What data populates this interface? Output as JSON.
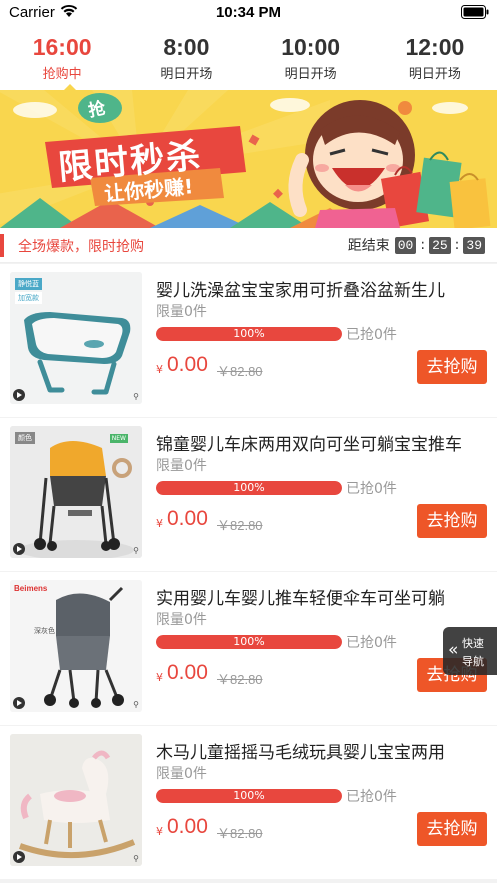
{
  "status_bar": {
    "carrier": "Carrier",
    "time": "10:34 PM"
  },
  "tabs": [
    {
      "time": "16:00",
      "status": "抢购中",
      "active": true
    },
    {
      "time": "8:00",
      "status": "明日开场",
      "active": false
    },
    {
      "time": "10:00",
      "status": "明日开场",
      "active": false
    },
    {
      "time": "12:00",
      "status": "明日开场",
      "active": false
    }
  ],
  "banner": {
    "badge": "抢",
    "headline": "限时秒杀",
    "subline": "让你秒赚!"
  },
  "strip": {
    "title": "全场爆款，限时抢购",
    "countdown_label": "距结束",
    "hours": "00",
    "minutes": "25",
    "seconds": "39"
  },
  "products": [
    {
      "title": "婴儿洗澡盆宝宝家用可折叠浴盆新生儿",
      "limit": "限量0件",
      "progress_label": "100%",
      "progress": 1.0,
      "sold": "已抢0件",
      "currency": "¥",
      "price": "0.00",
      "original_price": "￥82.80",
      "button": "去抢购",
      "thumb_badge": "静悦蓝",
      "thumb_badge2": "加宽款"
    },
    {
      "title": "锦童婴儿车床两用双向可坐可躺宝宝推车",
      "limit": "限量0件",
      "progress_label": "100%",
      "progress": 1.0,
      "sold": "已抢0件",
      "currency": "¥",
      "price": "0.00",
      "original_price": "￥82.80",
      "button": "去抢购",
      "thumb_badge": "颜色",
      "thumb_tag": "NEW"
    },
    {
      "title": "实用婴儿车婴儿推车轻便伞车可坐可躺",
      "limit": "限量0件",
      "progress_label": "100%",
      "progress": 1.0,
      "sold": "已抢0件",
      "currency": "¥",
      "price": "0.00",
      "original_price": "￥82.80",
      "button": "去抢购",
      "thumb_brand": "Beimens",
      "thumb_note": "深灰色"
    },
    {
      "title": "木马儿童摇摇马毛绒玩具婴儿宝宝两用",
      "limit": "限量0件",
      "progress_label": "100%",
      "progress": 1.0,
      "sold": "已抢0件",
      "currency": "¥",
      "price": "0.00",
      "original_price": "￥82.80",
      "button": "去抢购"
    }
  ],
  "quick_nav": {
    "line1": "快速",
    "line2": "导航"
  },
  "colors": {
    "accent": "#e8473e",
    "button": "#ee5628",
    "banner_bg": "#f9d64e"
  }
}
